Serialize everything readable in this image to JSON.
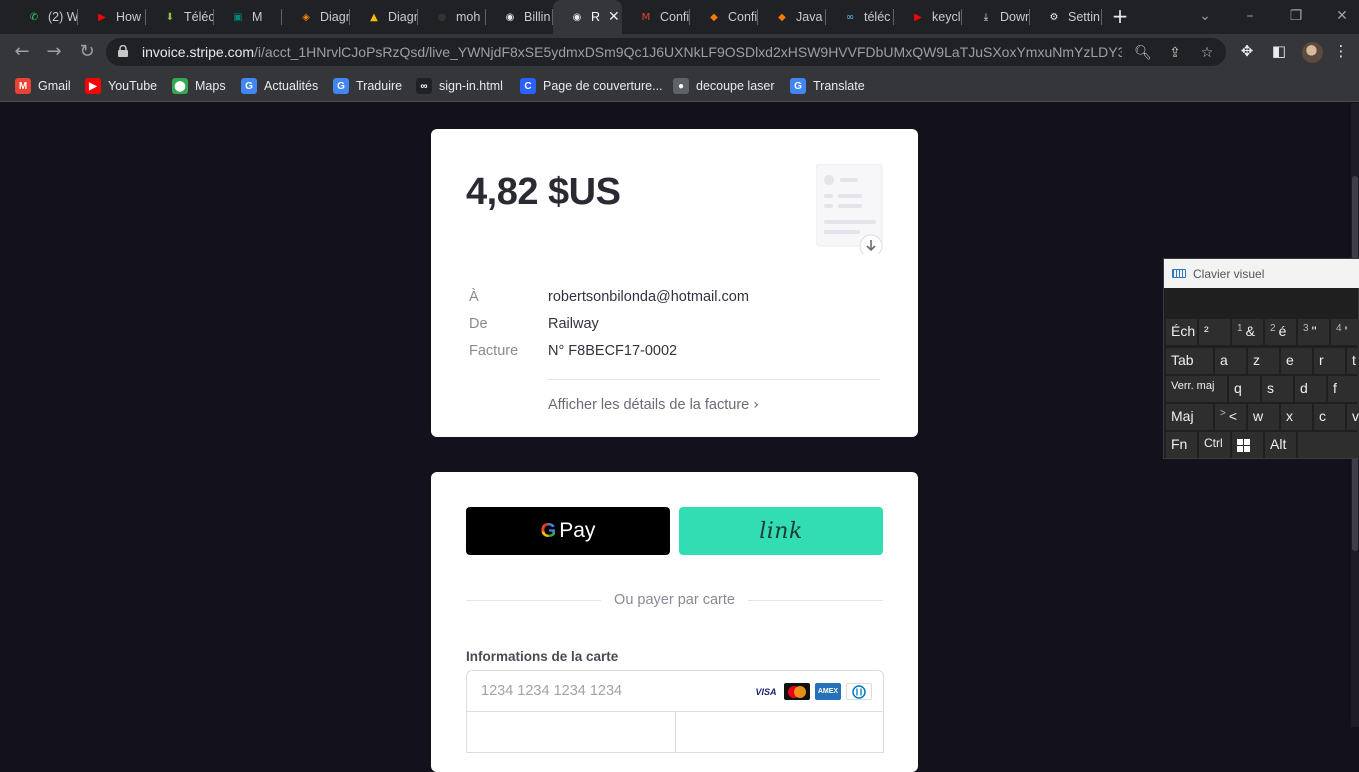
{
  "tabs": [
    {
      "label": "(2) W",
      "icon": "whatsapp-icon",
      "color": "#25d366"
    },
    {
      "label": "How",
      "icon": "youtube-icon",
      "color": "#ff0000"
    },
    {
      "label": "Téléc",
      "icon": "download-arrow-icon",
      "color": "#8bc34a"
    },
    {
      "label": "M",
      "icon": "meet-icon",
      "color": "#00897b"
    },
    {
      "label": "Diagr",
      "icon": "diagram-icon",
      "color": "#f08705"
    },
    {
      "label": "Diagr",
      "icon": "drive-icon",
      "color": "#fbbc05"
    },
    {
      "label": "moh",
      "icon": "github-icon",
      "color": "#333333"
    },
    {
      "label": "Billin",
      "icon": "railway-icon",
      "color": "#e8eaed"
    },
    {
      "label": "R",
      "icon": "railway-icon",
      "color": "#e8eaed"
    },
    {
      "label": "Confi",
      "icon": "gmail-icon",
      "color": "#ea4335"
    },
    {
      "label": "Confi",
      "icon": "box-icon",
      "color": "#f57c00"
    },
    {
      "label": "Java",
      "icon": "box-icon",
      "color": "#f57c00"
    },
    {
      "label": "téléc",
      "icon": "link-icon",
      "color": "#4fc3f7"
    },
    {
      "label": "keycl",
      "icon": "youtube-icon",
      "color": "#ff0000"
    },
    {
      "label": "Down",
      "icon": "download-icon",
      "color": "#e8eaed"
    },
    {
      "label": "Settin",
      "icon": "gear-icon",
      "color": "#e8eaed"
    }
  ],
  "address_bar": {
    "domain": "invoice.stripe.com",
    "path": "/i/acct_1HNrvlCJoPsRzQsd/live_YWNjdF8xSE5ydmxDSm9Qc1J6UXNkLF9OSDlxd2xHSW9HVVFDbUMxQW9LaTJuSXoxYmxuNmYzLDY3NDY0..."
  },
  "bookmarks": [
    {
      "label": "Gmail",
      "icon": "gmail-icon",
      "color": "#ea4335"
    },
    {
      "label": "YouTube",
      "icon": "youtube-icon",
      "color": "#ff0000"
    },
    {
      "label": "Maps",
      "icon": "maps-icon",
      "color": "#34a853"
    },
    {
      "label": "Actualités",
      "icon": "news-icon",
      "color": "#4285f4"
    },
    {
      "label": "Traduire",
      "icon": "translate-icon",
      "color": "#4285f4"
    },
    {
      "label": "sign-in.html",
      "icon": "glasses-icon",
      "color": "#202124"
    },
    {
      "label": "Page de couverture...",
      "icon": "c-icon",
      "color": "#2962ff"
    },
    {
      "label": "decoupe laser",
      "icon": "circle-icon",
      "color": "#5f6368"
    },
    {
      "label": "Translate",
      "icon": "translate-icon",
      "color": "#4285f4"
    }
  ],
  "invoice": {
    "amount": "4,82 $US",
    "to_label": "À",
    "to_value": "robertsonbilonda@hotmail.com",
    "from_label": "De",
    "from_value": "Railway",
    "invoice_label": "Facture",
    "invoice_value": "N° F8BECF17-0002",
    "details_link": "Afficher les détails de la facture"
  },
  "payment": {
    "gpay_label": "Pay",
    "link_label": "link",
    "or_text": "Ou payer par carte",
    "card_label": "Informations de la carte",
    "card_placeholder": "1234 1234 1234 1234",
    "brands": [
      "VISA",
      "MC",
      "AMEX",
      "DC"
    ]
  },
  "keyboard": {
    "title": "Clavier visuel",
    "rows": [
      [
        "Éch",
        "²",
        "&",
        "é",
        "\"",
        "'"
      ],
      [
        "Tab",
        "a",
        "z",
        "e",
        "r",
        "t"
      ],
      [
        "Verr. maj",
        "q",
        "s",
        "d",
        "f"
      ],
      [
        "Maj",
        "<",
        "w",
        "x",
        "c",
        "v"
      ],
      [
        "Fn",
        "Ctrl",
        "",
        "Alt",
        ""
      ]
    ],
    "subs": {
      "1": "1",
      "2": "2",
      "3": "3",
      "4": "4",
      "gt": ">"
    }
  }
}
